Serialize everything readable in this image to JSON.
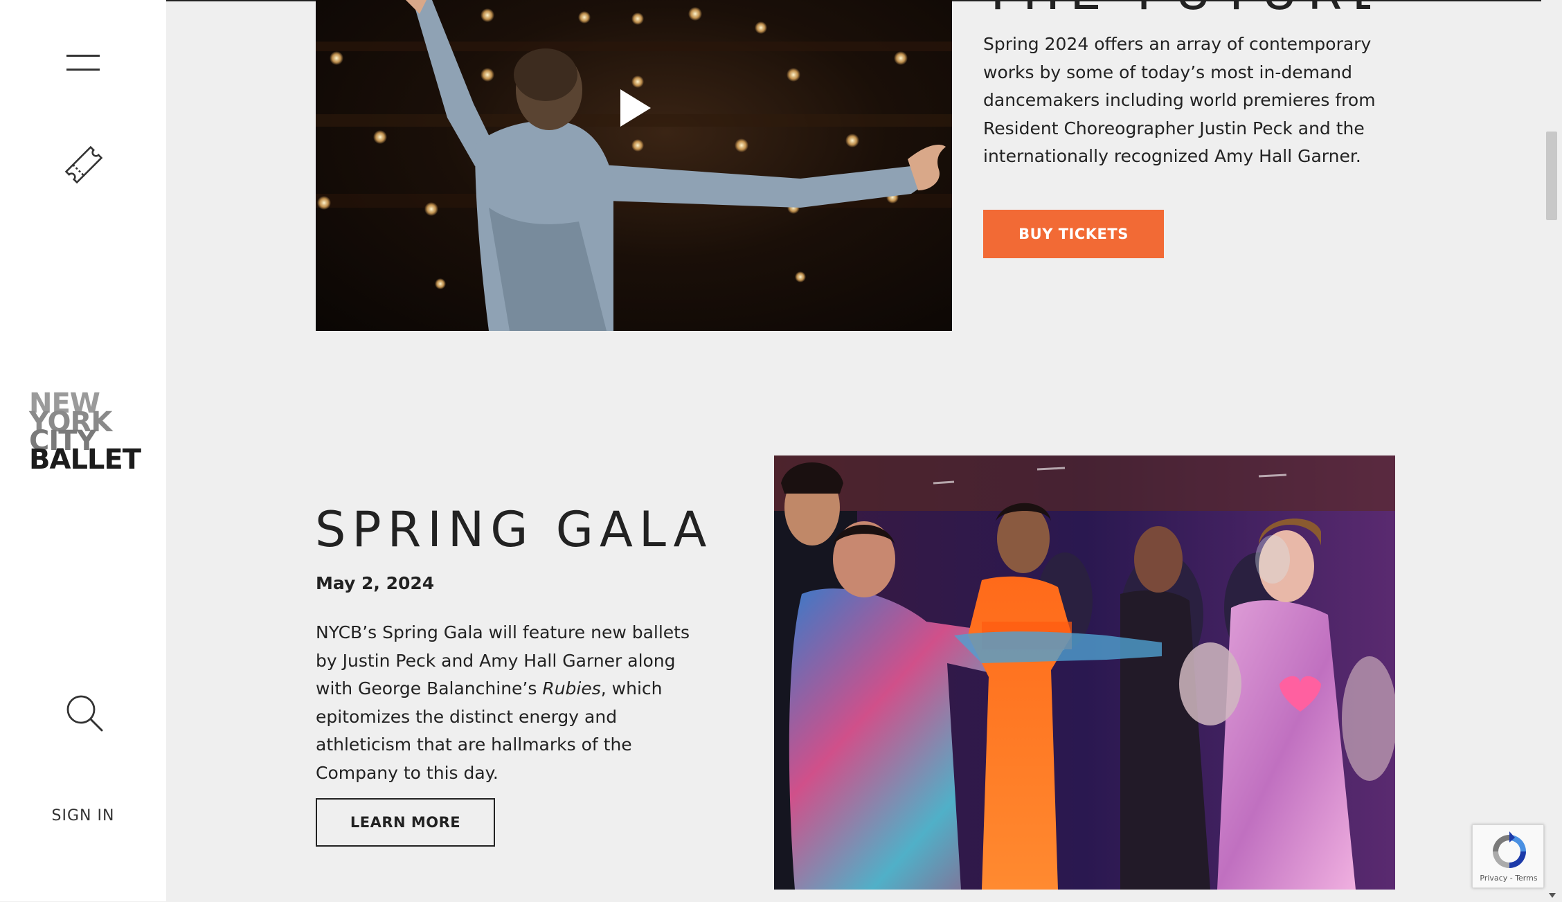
{
  "sidebar": {
    "menu_icon": "hamburger-menu-icon",
    "tickets_icon": "ticket-icon",
    "logo_lines": [
      "NEW",
      "YORK",
      "CITY",
      "BALLET"
    ],
    "search_icon": "search-icon",
    "signin_label": "SIGN IN"
  },
  "future": {
    "heading": "THE FUTURE",
    "body": "Spring 2024 offers an array of contemporary works by some of today’s most in-demand dancemakers including world premieres from Resident Choreographer Justin Peck and the internationally recognized Amy Hall Garner.",
    "buy_label": "BUY TICKETS",
    "video_icon": "play-icon"
  },
  "gala": {
    "title": "SPRING GALA",
    "date": "May 2, 2024",
    "body_before": "NYCB’s Spring Gala will feature new ballets by Justin Peck and Amy Hall Garner along with George Balanchine’s ",
    "body_italic": "Rubies",
    "body_after": ", which epitomizes the distinct energy and athleticism that are hallmarks of the Company to this day.",
    "learn_label": "LEARN MORE"
  },
  "recaptcha": {
    "privacy": "Privacy",
    "separator": " - ",
    "terms": "Terms"
  },
  "colors": {
    "accent": "#f26a35",
    "page_bg": "#efefef",
    "sidebar_bg": "#ffffff",
    "text": "#222222"
  }
}
